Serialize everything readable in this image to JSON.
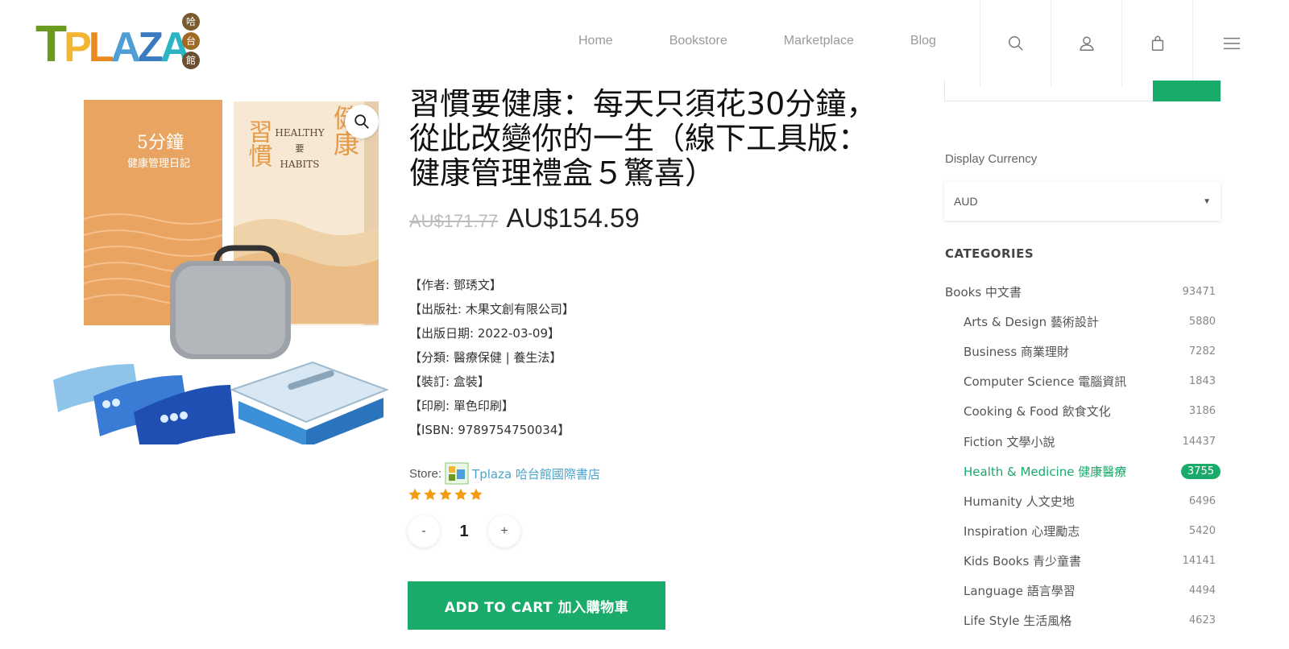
{
  "header": {
    "logo": {
      "word": [
        "T",
        "P",
        "L",
        "A",
        "Z",
        "A"
      ],
      "chinese": [
        "哈",
        "台",
        "館"
      ]
    },
    "nav": [
      {
        "label": "Home"
      },
      {
        "label": "Bookstore"
      },
      {
        "label": "Marketplace"
      },
      {
        "label": "Blog"
      }
    ],
    "icons": [
      "search-icon",
      "account-icon",
      "cart-icon",
      "menu-icon"
    ]
  },
  "product": {
    "title": "習慣要健康：每天只須花30分鐘，從此改變你的一生（線下工具版：健康管理禮盒５驚喜）",
    "price_old": "AU$171.77",
    "price_new": "AU$154.59",
    "meta": [
      {
        "text": "【作者: 鄧琇文】"
      },
      {
        "text": "【出版社: 木果文創有限公司】"
      },
      {
        "text": "【出版日期: 2022-03-09】"
      },
      {
        "text": "【分類: 醫療保健 | 養生法】"
      },
      {
        "text": "【裝訂: 盒裝】"
      },
      {
        "text": "【印刷: 單色印刷】"
      },
      {
        "text": "【ISBN: 9789754750034】"
      }
    ],
    "store_label": "Store:",
    "store_name": "Tplaza 哈台館國際書店",
    "rating": 5,
    "quantity": "1",
    "qty_minus": "-",
    "qty_plus": "+",
    "add_to_cart": "ADD TO CART 加入購物車",
    "image_text": {
      "book1_title": "5分鐘",
      "book1_subtitle": "健康管理日記",
      "book2_title_en1": "HEALTHY",
      "book2_mid": "要",
      "book2_title_en2": "HABITS",
      "book2_cn_left": "習慣",
      "book2_cn_right": "健康"
    }
  },
  "sidebar": {
    "currency_label": "Display Currency",
    "currency_value": "AUD",
    "categories_title": "CATEGORIES",
    "categories": [
      {
        "label": "Books 中文書",
        "count": "93471",
        "sub": false,
        "active": false
      },
      {
        "label": "Arts & Design 藝術設計",
        "count": "5880",
        "sub": true,
        "active": false
      },
      {
        "label": "Business 商業理財",
        "count": "7282",
        "sub": true,
        "active": false
      },
      {
        "label": "Computer Science 電腦資訊",
        "count": "1843",
        "sub": true,
        "active": false
      },
      {
        "label": "Cooking & Food 飲食文化",
        "count": "3186",
        "sub": true,
        "active": false
      },
      {
        "label": "Fiction 文學小說",
        "count": "14437",
        "sub": true,
        "active": false
      },
      {
        "label": "Health & Medicine 健康醫療",
        "count": "3755",
        "sub": true,
        "active": true
      },
      {
        "label": "Humanity 人文史地",
        "count": "6496",
        "sub": true,
        "active": false
      },
      {
        "label": "Inspiration 心理勵志",
        "count": "5420",
        "sub": true,
        "active": false
      },
      {
        "label": "Kids Books 青少童書",
        "count": "14141",
        "sub": true,
        "active": false
      },
      {
        "label": "Language 語言學習",
        "count": "4494",
        "sub": true,
        "active": false
      },
      {
        "label": "Life Style 生活風格",
        "count": "4623",
        "sub": true,
        "active": false
      }
    ]
  },
  "colors": {
    "accent": "#1aab6b",
    "link": "#4da3c9",
    "star": "#f39c12"
  }
}
